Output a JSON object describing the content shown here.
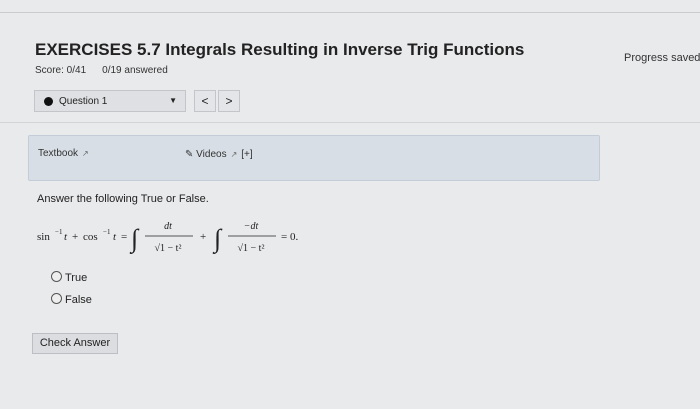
{
  "header": {
    "title": "EXERCISES 5.7 Integrals Resulting in Inverse Trig Functions",
    "progress": "Progress saved",
    "score": "Score: 0/41",
    "answered": "0/19 answered"
  },
  "question_nav": {
    "current": "Question 1",
    "prev_icon": "<",
    "next_icon": ">"
  },
  "resources": {
    "textbook": "Textbook",
    "videos": "Videos",
    "videos_more": "[+]"
  },
  "question": {
    "instruction": "Answer the following True or False.",
    "equation": {
      "lhs_a": "sin",
      "lhs_b": "cos",
      "inv": "−1",
      "var": "t",
      "numerator_1": "dt",
      "numerator_2": "−dt",
      "denominator": "√1 − t²",
      "rhs": "= 0."
    },
    "options": [
      "True",
      "False"
    ]
  },
  "actions": {
    "check_answer": "Check Answer"
  },
  "icons": {
    "external_link": "external-link-icon",
    "video": "video-icon",
    "radio": "radio-icon"
  }
}
